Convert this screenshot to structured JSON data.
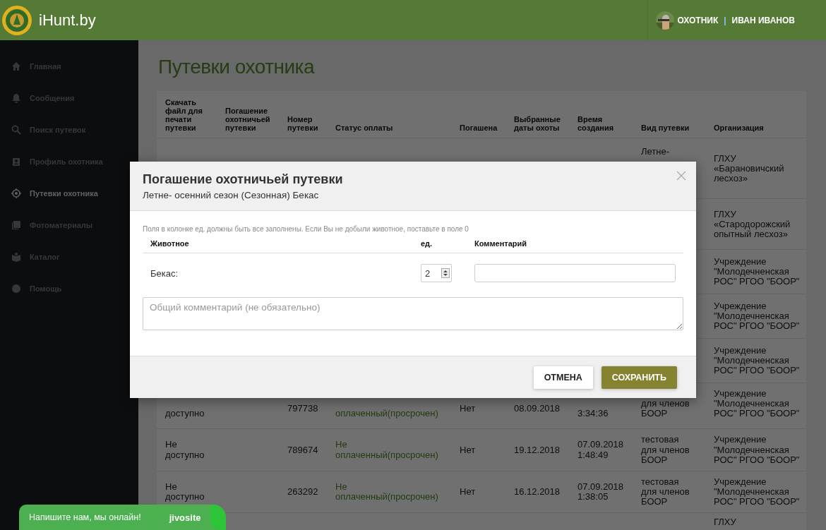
{
  "header": {
    "brand": "iHunt.by",
    "user": {
      "role": "ОХОТНИК",
      "separator": "|",
      "name": "ИВАН ИВАНОВ"
    }
  },
  "sidebar": {
    "items": [
      {
        "label": "Главная",
        "selected": false
      },
      {
        "label": "Сообщения",
        "selected": false
      },
      {
        "label": "Поиск путевок",
        "selected": false
      },
      {
        "label": "Профиль охотника",
        "selected": false
      },
      {
        "label": "Путевки охотника",
        "selected": true
      },
      {
        "label": "Фотоматериалы",
        "selected": false
      },
      {
        "label": "Каталог",
        "selected": false
      },
      {
        "label": "Помощь",
        "selected": false
      }
    ]
  },
  "page_title": "Путевки охотника",
  "table": {
    "columns": [
      "Скачать файл для печати путевки",
      "Погашение охотничьей путевки",
      "Номер путевки",
      "Статус оплаты",
      "Погашена",
      "Выбранные даты охоты",
      "Время создания",
      "Вид путевки",
      "Организация"
    ],
    "rows": [
      {
        "cells": [
          null,
          null,
          null,
          null,
          null,
          null,
          null,
          "Летне-",
          "ГЛХУ «Барановичский лесхоз»"
        ]
      },
      {
        "cells": [
          null,
          null,
          null,
          null,
          null,
          null,
          null,
          null,
          "ГЛХУ «Стародорожский опытный лесхоз»"
        ]
      },
      {
        "cells": [
          null,
          null,
          null,
          null,
          null,
          null,
          null,
          null,
          "Учреждение \"Молодечненская РОС\" РГОО \"БООР\""
        ]
      },
      {
        "cells": [
          null,
          null,
          null,
          null,
          null,
          null,
          null,
          null,
          "Учреждение \"Молодечненская РОС\" РГОО \"БООР\""
        ]
      },
      {
        "cells": [
          null,
          null,
          null,
          null,
          null,
          null,
          null,
          null,
          "Учреждение \"Молодечненская РОС\" РГОО \"БООР\""
        ]
      },
      {
        "cells": [
          "доступно",
          null,
          "797738",
          "оплаченный(просрочен)",
          "Нет",
          "08.09.2018",
          "3:34:36",
          "для членов БООР",
          "Учреждение \"Молодечненская РОС\" РГОО \"БООР\""
        ]
      },
      {
        "cells": [
          "Не доступно",
          null,
          "789674",
          "Не оплаченный(просрочен)",
          "Нет",
          "19.12.2018",
          "07.09.2018 1:48:49",
          "тестовая для членов БООР",
          "Учреждение \"Молодечненская РОС\" РГОО \"БООР\""
        ]
      },
      {
        "cells": [
          "Не доступно",
          null,
          "263292",
          "Не оплаченный(просрочен)",
          "Нет",
          "16.12.2018",
          "07.09.2018 1:38:05",
          "тестовая для членов БООР",
          "Учреждение \"Молодечненская РОС\" РГОО \"БООР\""
        ]
      },
      {
        "cells": [
          null,
          null,
          null,
          null,
          null,
          null,
          null,
          null,
          "ГЛХУ"
        ]
      }
    ]
  },
  "modal": {
    "title": "Погашение охотничьей путевки",
    "subtitle": "Летне- осенний сезон (Сезонная) Бекас",
    "hint": "Поля в колонке ед. должны быть все заполнены. Если Вы не добыли животное, поставьте в поле 0",
    "columns": [
      "Животное",
      "ед.",
      "Комментарий"
    ],
    "animals": [
      {
        "name": "Бекас:",
        "count": "2"
      }
    ],
    "comment_placeholder": "Общий комментарий (не обязательно)",
    "buttons": [
      {
        "label": "ОТМЕНА",
        "kind": "secondary"
      },
      {
        "label": "СОХРАНИТЬ",
        "kind": "primary"
      }
    ]
  },
  "chat": {
    "text": "Напишите нам, мы онлайн!",
    "brand": "jivosite"
  }
}
